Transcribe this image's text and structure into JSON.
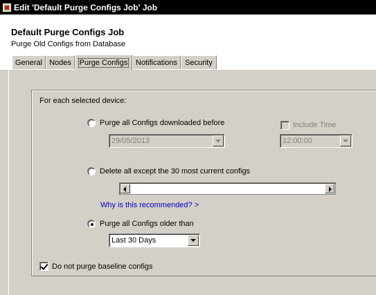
{
  "window": {
    "title": "Edit 'Default Purge Configs Job' Job"
  },
  "header": {
    "job_name": "Default Purge Configs Job",
    "job_description": "Purge Old Configs from Database"
  },
  "tabs": [
    {
      "label": "General"
    },
    {
      "label": "Nodes"
    },
    {
      "label": "Purge Configs",
      "active": true
    },
    {
      "label": "Notifications"
    },
    {
      "label": "Security"
    }
  ],
  "purge": {
    "intro": "For each selected device:",
    "option_before": {
      "label": "Purge all Configs downloaded before",
      "selected": false,
      "date_value": "29/05/2013"
    },
    "include_time": {
      "label": "Include Time",
      "checked": false,
      "time_value": "12:00:00"
    },
    "option_except": {
      "label": "Delete all except the 30 most current configs",
      "selected": false,
      "slider_value": 30
    },
    "why_link": "Why is this recommended? >",
    "option_older": {
      "label": "Purge all Configs older than",
      "selected": true,
      "period_value": "Last 30 Days"
    },
    "baseline": {
      "label": "Do not purge baseline configs",
      "checked": true
    }
  },
  "colors": {
    "title_bar": "#000000",
    "panel": "#d4d0c8",
    "link": "#0000cc"
  }
}
